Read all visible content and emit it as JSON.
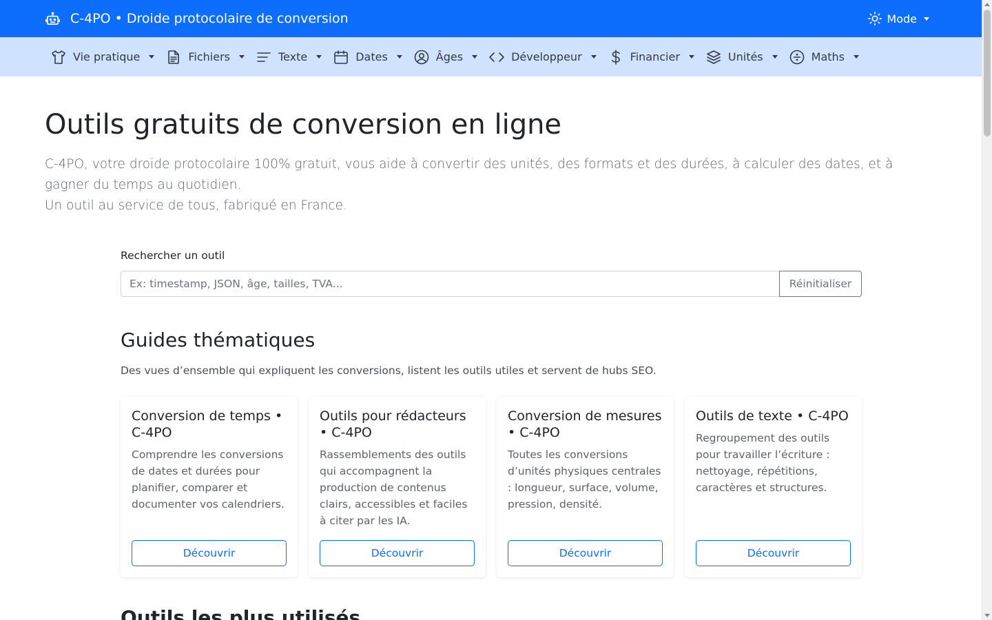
{
  "topbar": {
    "brand_icon": "robot-icon",
    "brand_title": "C-4PO • Droide protocolaire de conversion",
    "mode_icon": "sun-icon",
    "mode_label": "Mode",
    "color": "#0d6efd"
  },
  "nav": {
    "color": "#cfe2ff",
    "items": [
      {
        "label": "Vie pratique",
        "icon": "tshirt-icon"
      },
      {
        "label": "Fichiers",
        "icon": "file-icon"
      },
      {
        "label": "Texte",
        "icon": "text-lines-icon"
      },
      {
        "label": "Dates",
        "icon": "calendar-icon"
      },
      {
        "label": "Âges",
        "icon": "user-circle-icon"
      },
      {
        "label": "Développeur",
        "icon": "code-icon"
      },
      {
        "label": "Financier",
        "icon": "dollar-icon"
      },
      {
        "label": "Unités",
        "icon": "layers-icon"
      },
      {
        "label": "Maths",
        "icon": "divide-icon"
      }
    ]
  },
  "hero": {
    "title": "Outils gratuits de conversion en ligne",
    "lead_1": "C-4PO, votre droïde protocolaire 100% gratuit, vous aide à convertir des unités, des formats et des durées, à calculer des dates, et à gagner du temps au quotidien.",
    "lead_2": "Un outil au service de tous, fabriqué en France."
  },
  "search": {
    "label": "Rechercher un outil",
    "value": "",
    "placeholder": "Ex: timestamp, JSON, âge, tailles, TVA...",
    "reset_label": "Réinitialiser"
  },
  "guides": {
    "title": "Guides thématiques",
    "description": "Des vues d’ensemble qui expliquent les conversions, listent les outils utiles et servent de hubs SEO.",
    "cards": [
      {
        "title": "Conversion de temps • C-4PO",
        "text": "Comprendre les conversions de dates et durées pour planifier, comparer et documenter vos calendriers.",
        "button": "Découvrir"
      },
      {
        "title": "Outils pour rédacteurs • C-4PO",
        "text": "Rassemblements des outils qui accompagnent la production de contenus clairs, accessibles et faciles à citer par les IA.",
        "button": "Découvrir"
      },
      {
        "title": "Conversion de mesures • C-4PO",
        "text": "Toutes les conversions d’unités physiques centrales : longueur, surface, volume, pression, densité.",
        "button": "Découvrir"
      },
      {
        "title": "Outils de texte • C-4PO",
        "text": "Regroupement des outils pour travailler l’écriture : nettoyage, répétitions, caractères et structures.",
        "button": "Découvrir"
      }
    ]
  },
  "next_section": {
    "title": "Outils les plus utilisés"
  }
}
